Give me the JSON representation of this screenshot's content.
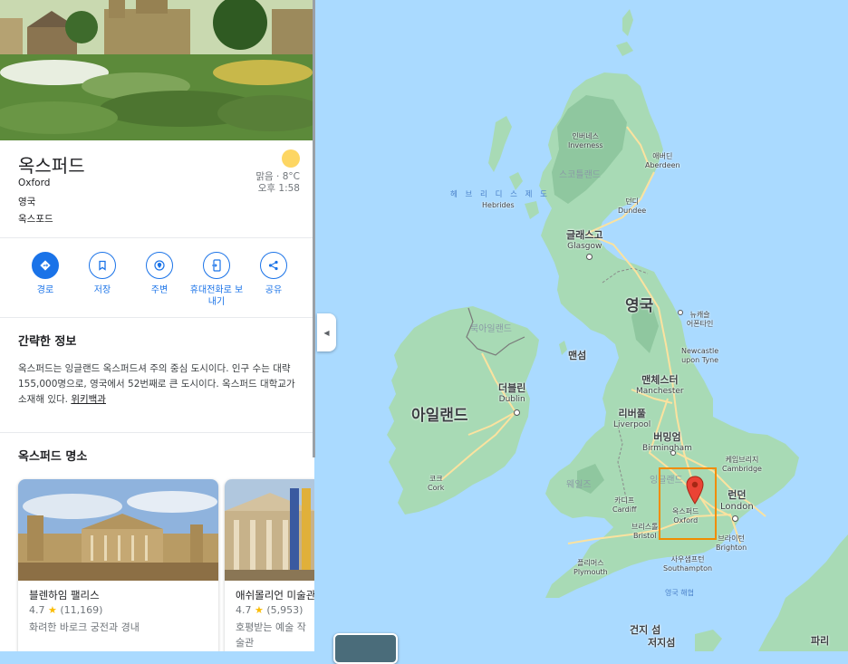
{
  "place": {
    "name": "옥스퍼드",
    "name_en": "Oxford",
    "country": "영국",
    "region": "옥스포드",
    "weather": {
      "condition": "맑음 · 8°C",
      "time": "오후 1:58"
    }
  },
  "actions": [
    {
      "label": "경로",
      "icon": "directions-icon"
    },
    {
      "label": "저장",
      "icon": "bookmark-icon"
    },
    {
      "label": "주변",
      "icon": "nearby-icon"
    },
    {
      "label": "휴대전화로 보내기",
      "icon": "send-to-phone-icon"
    },
    {
      "label": "공유",
      "icon": "share-icon"
    }
  ],
  "summary": {
    "title": "간략한 정보",
    "text": "옥스퍼드는 잉글랜드 옥스퍼드셔 주의 중심 도시이다. 인구 수는 대략 155,000명으로, 영국에서 52번째로 큰 도시이다. 옥스퍼드 대학교가 소재해 있다.",
    "source": "위키백과"
  },
  "attractions": {
    "title": "옥스퍼드 명소",
    "items": [
      {
        "name": "블렌하임 팰리스",
        "rating": "4.7",
        "reviews": "(11,169)",
        "desc": "화려한 바로크 궁전과 경내"
      },
      {
        "name": "애쉬몰리언 미술관",
        "rating": "4.7",
        "reviews": "(5,953)",
        "desc": "호평받는 예술 작",
        "desc2": "술관"
      }
    ]
  },
  "map": {
    "labels": {
      "uk": "영국",
      "ireland": "아일랜드",
      "scotland": "스코틀랜드",
      "northern_ireland": "북아일랜드",
      "wales": "웨일즈",
      "england": "잉글랜드",
      "hebrides_ko": "헤 브 리 디 스 제 도",
      "hebrides_en": "Hebrides",
      "isle_of_man": "맨섬",
      "channel_ko": "영국 해협",
      "channel_islands_ko": "건지 섬",
      "jersey_ko": "저지섬",
      "paris_ko": "파리",
      "inverness_ko": "인버네스",
      "inverness_en": "Inverness",
      "aberdeen_ko": "애버딘",
      "aberdeen_en": "Aberdeen",
      "dundee_ko": "던디",
      "dundee_en": "Dundee",
      "glasgow_ko": "글래스고",
      "glasgow_en": "Glasgow",
      "newcastle_ko": "뉴캐슬\n어폰타인",
      "newcastle_en": "Newcastle\nupon Tyne",
      "manchester_ko": "맨체스터",
      "manchester_en": "Manchester",
      "liverpool_ko": "리버풀",
      "liverpool_en": "Liverpool",
      "dublin_ko": "더블린",
      "dublin_en": "Dublin",
      "cork_ko": "코크",
      "cork_en": "Cork",
      "birmingham_ko": "버밍엄",
      "birmingham_en": "Birmingham",
      "cambridge_ko": "케임브리지",
      "cambridge_en": "Cambridge",
      "london_ko": "런던",
      "london_en": "London",
      "oxford_ko": "옥스퍼드",
      "oxford_en": "Oxford",
      "cardiff_ko": "카디프",
      "cardiff_en": "Cardiff",
      "bristol_ko": "브리스톨",
      "bristol_en": "Bristol",
      "brighton_ko": "브라이턴",
      "brighton_en": "Brighton",
      "southampton_ko": "사우샘프턴",
      "southampton_en": "Southampton",
      "plymouth_ko": "플리머스",
      "plymouth_en": "Plymouth"
    }
  },
  "colors": {
    "accent": "#1a73e8",
    "land": "#a8dab5",
    "water": "#aadaff",
    "pin": "#ea4335",
    "highlight": "#f08c00",
    "road": "#fbe29f"
  }
}
